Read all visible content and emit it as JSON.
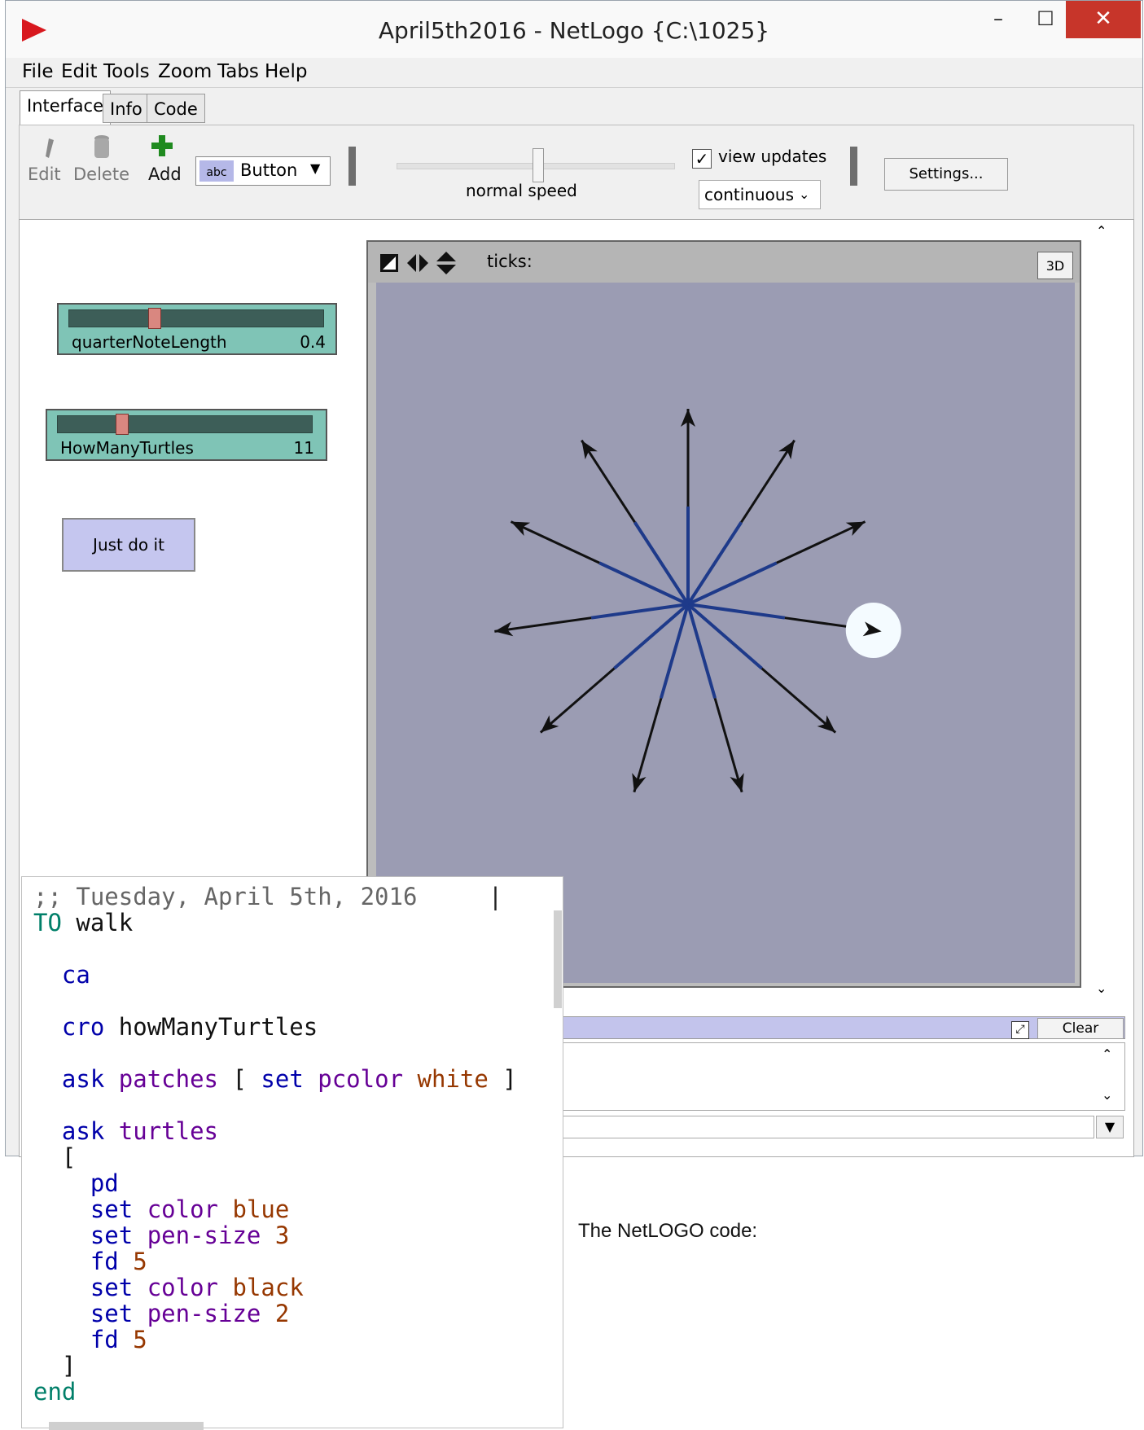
{
  "window": {
    "title": "April5th2016 - NetLogo {C:\\1025}",
    "minimize": "–",
    "maximize": "☐",
    "close": "✕"
  },
  "menubar": {
    "items": [
      "File",
      "Edit",
      "Tools",
      "Zoom",
      "Tabs",
      "Help"
    ]
  },
  "tabs": {
    "interface": "Interface",
    "info": "Info",
    "code": "Code"
  },
  "toolbar": {
    "edit": "Edit",
    "delete": "Delete",
    "add": "Add",
    "widget_type": "Button",
    "widget_abc": "abc",
    "speed_label": "normal speed",
    "view_updates_label": "view updates",
    "view_updates_checked": true,
    "update_mode": "continuous",
    "settings": "Settings..."
  },
  "widgets": {
    "slider1": {
      "name": "quarterNoteLength",
      "value": "0.4",
      "fraction": 0.33
    },
    "slider2": {
      "name": "HowManyTurtles",
      "value": "11",
      "fraction": 0.24
    },
    "button": "Just do it"
  },
  "view": {
    "ticks_label": "ticks:",
    "btn_3d": "3D",
    "turtle_count": 11,
    "headings_deg": [
      0,
      33,
      65,
      98,
      131,
      164,
      196,
      229,
      262,
      295,
      327
    ],
    "distance_inner": 5,
    "distance_outer": 10,
    "inner_color": "#1e3a8a",
    "outer_color": "#111111",
    "background": "#9b9cb3"
  },
  "command_center": {
    "clear": "Clear"
  },
  "code": {
    "line1": ";; Tuesday, April 5th, 2016",
    "to": "TO",
    "walk": "walk",
    "ca": "ca",
    "cro": "cro",
    "cro_arg": "howManyTurtles",
    "ask": "ask",
    "patches": "patches",
    "lb": "[",
    "set": "set",
    "pcolor": "pcolor",
    "white": "white",
    "rb": "]",
    "turtles": "turtles",
    "pd": "pd",
    "color": "color",
    "blue": "blue",
    "pen_size": "pen-size",
    "three": "3",
    "fd": "fd",
    "five": "5",
    "black": "black",
    "two": "2",
    "end": "end"
  },
  "caption": "The NetLOGO code:"
}
